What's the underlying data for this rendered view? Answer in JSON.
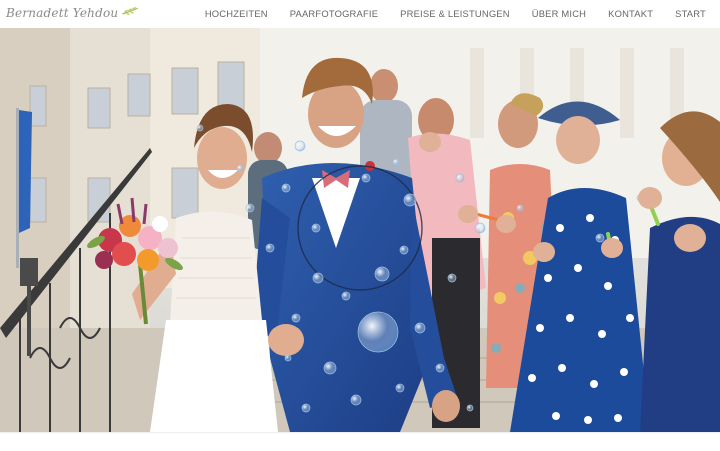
{
  "site": {
    "logo_text": "Bernadett Yehdou",
    "logo_icon": "leaf-branch-icon"
  },
  "nav": {
    "items": [
      {
        "label": "HOCHZEITEN"
      },
      {
        "label": "PAARFOTOGRAFIE"
      },
      {
        "label": "PREISE & LEISTUNGEN"
      },
      {
        "label": "ÜBER MICH"
      },
      {
        "label": "KONTAKT"
      },
      {
        "label": "START"
      }
    ]
  },
  "colors": {
    "accent_leaf": "#b9cf6a",
    "nav_text": "#666666",
    "logo_text": "#8a8a8a"
  }
}
